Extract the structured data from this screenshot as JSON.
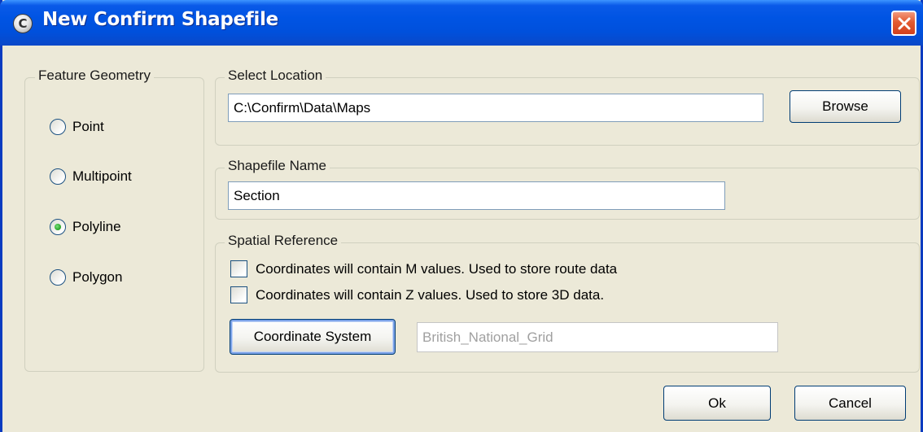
{
  "window": {
    "title": "New Confirm Shapefile",
    "app_icon_glyph": "C"
  },
  "feature_geometry": {
    "legend": "Feature Geometry",
    "options": [
      {
        "label": "Point",
        "checked": false
      },
      {
        "label": "Multipoint",
        "checked": false
      },
      {
        "label": "Polyline",
        "checked": true
      },
      {
        "label": "Polygon",
        "checked": false
      }
    ]
  },
  "select_location": {
    "legend": "Select Location",
    "value": "C:\\Confirm\\Data\\Maps",
    "browse_label": "Browse"
  },
  "shapefile_name": {
    "legend": "Shapefile Name",
    "value": "Section"
  },
  "spatial_reference": {
    "legend": "Spatial Reference",
    "m_values_label": "Coordinates will contain M values. Used to store route data",
    "z_values_label": "Coordinates will contain Z values.  Used to store 3D data.",
    "m_values_checked": false,
    "z_values_checked": false,
    "coordinate_system_label": "Coordinate System",
    "coordinate_system_value": "British_National_Grid"
  },
  "buttons": {
    "ok": "Ok",
    "cancel": "Cancel"
  },
  "colors": {
    "titlebar": "#0054e3",
    "close": "#e35a30",
    "dialog_bg": "#ece9d8",
    "radio_checked": "#21a121"
  }
}
